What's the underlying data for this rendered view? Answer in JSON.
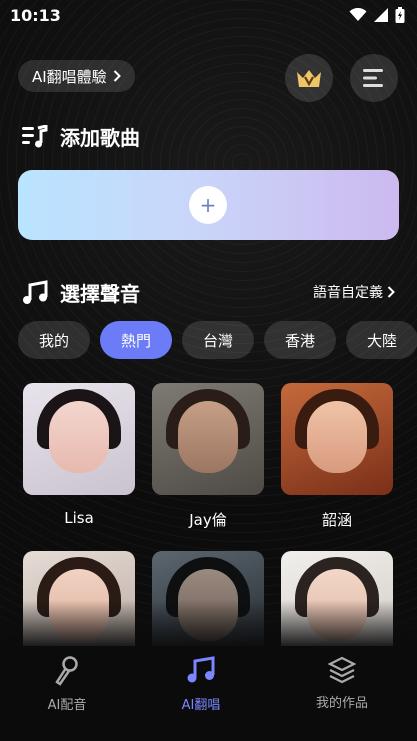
{
  "status_bar": {
    "time": "10:13"
  },
  "header": {
    "experience_label": "AI翻唱體驗"
  },
  "add_song": {
    "title": "添加歌曲",
    "add_symbol": "+"
  },
  "voice": {
    "title": "選擇聲音",
    "custom_link": "語音自定義",
    "tabs": [
      {
        "label": "我的"
      },
      {
        "label": "熱門"
      },
      {
        "label": "台灣"
      },
      {
        "label": "香港"
      },
      {
        "label": "大陸"
      }
    ],
    "active_tab": "熱門",
    "singers": [
      {
        "name": "Lisa"
      },
      {
        "name": "Jay倫"
      },
      {
        "name": "韶涵"
      },
      {
        "name": ""
      },
      {
        "name": ""
      },
      {
        "name": ""
      }
    ]
  },
  "bottom_nav": [
    {
      "label": "AI配音",
      "icon": "microphone-icon"
    },
    {
      "label": "AI翻唱",
      "icon": "music-note-icon"
    },
    {
      "label": "我的作品",
      "icon": "layers-icon"
    }
  ],
  "colors": {
    "accent": "#6b7cf6",
    "nav_active": "#7b87ff"
  }
}
